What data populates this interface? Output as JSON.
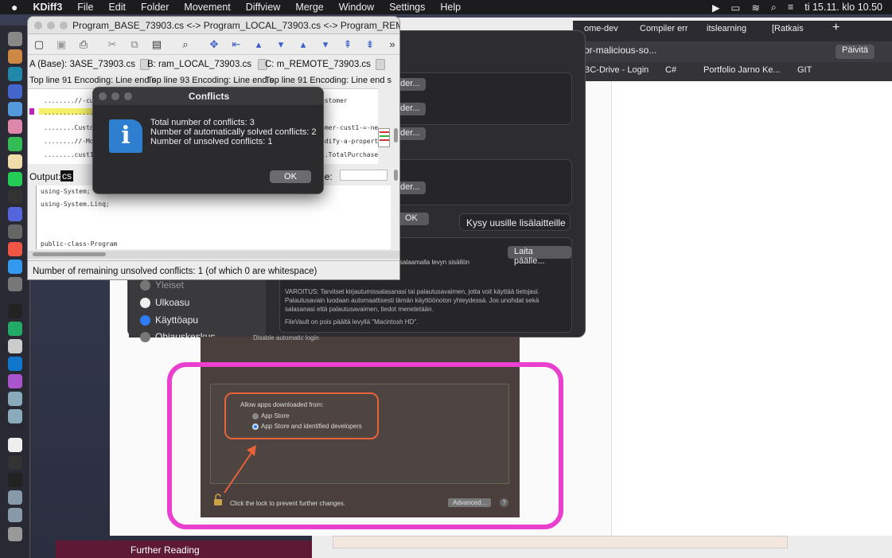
{
  "menubar": {
    "apple": "",
    "app": "KDiff3",
    "items": [
      "File",
      "Edit",
      "Folder",
      "Movement",
      "Diffview",
      "Merge",
      "Window",
      "Settings",
      "Help"
    ],
    "clock": "ti 15.11. klo 10.50"
  },
  "browser": {
    "tabs": [
      "ome-dev",
      "Compiler err",
      "itslearning",
      "[Ratkais"
    ],
    "address": "or-malicious-so...",
    "update_button": "Päivitä",
    "bookmarks": [
      "BC-Drive - Login",
      "C#",
      "Portfolio Jarno Ke...",
      "GIT"
    ],
    "further_reading": "Further Reading"
  },
  "settings": {
    "buttons": [
      "der...",
      "der...",
      "der...",
      "der..."
    ],
    "style_label": "yle:",
    "ok": "OK",
    "ask_new": "Kysy uusille lisälaitteille",
    "turn_on": "Laita päälle...",
    "filevault_partial": "salaamalla levyn sisällön",
    "warning": "VAROITUS: Tarvitset kirjautumissalasanasi tai palautusavaimen, jotta voit käyttää tietojasi. Palautusavain luodaan automaattisesti tämän käyttöönoton yhteydessä. Jos unohdat sekä salasanasi että palautusavaimen, tiedot menetetään.",
    "filevault_status": "FileVault on pois päältä levyllä \"Macintosh HD\".",
    "sidebar": [
      "Yleiset",
      "Ulkoasu",
      "Käyttöapu",
      "Ohjauskeskus"
    ]
  },
  "macshot": {
    "disable_login": "Disable automatic login",
    "allow_label": "Allow apps downloaded from:",
    "opt1": "App Store",
    "opt2": "App Store and identified developers",
    "lock_text": "Click the lock to prevent further changes.",
    "advanced": "Advanced...",
    "help": "?"
  },
  "kdiff": {
    "title": "Program_BASE_73903.cs <-> Program_LOCAL_73903.cs <-> Program_REMOT...",
    "pane_a": "A (Base): 3ASE_73903.cs",
    "pane_b": "B: ram_LOCAL_73903.cs",
    "pane_c": "C: m_REMOTE_73903.cs",
    "info_a": "Top line 91",
    "info_b": "Top line 93",
    "info_c": "Top line 91",
    "info_enc": "Encoding: Line end s",
    "code_a": [
      "........//-cus",
      ".............",
      "........Custon",
      "........//-Mod",
      "........cust1"
    ],
    "code_c": [
      "ustomer",
      "",
      "omer-cust1-=-ne",
      "odify-a-propert",
      "1.TotalPurchase"
    ],
    "output_label": "Output:",
    "output_file": "cs",
    "output_lines": [
      "using-System;",
      "using-System.Linq;",
      "",
      "",
      "public-class-Program"
    ],
    "status": "Number of remaining unsolved conflicts: 1 (of which 0 are whitespace)"
  },
  "dialog": {
    "title": "Conflicts",
    "icon": "i",
    "line1": "Total number of conflicts: 3",
    "line2": "Number of automatically solved conflicts: 2",
    "line3": "Number of unsolved conflicts: 1",
    "ok": "OK"
  }
}
